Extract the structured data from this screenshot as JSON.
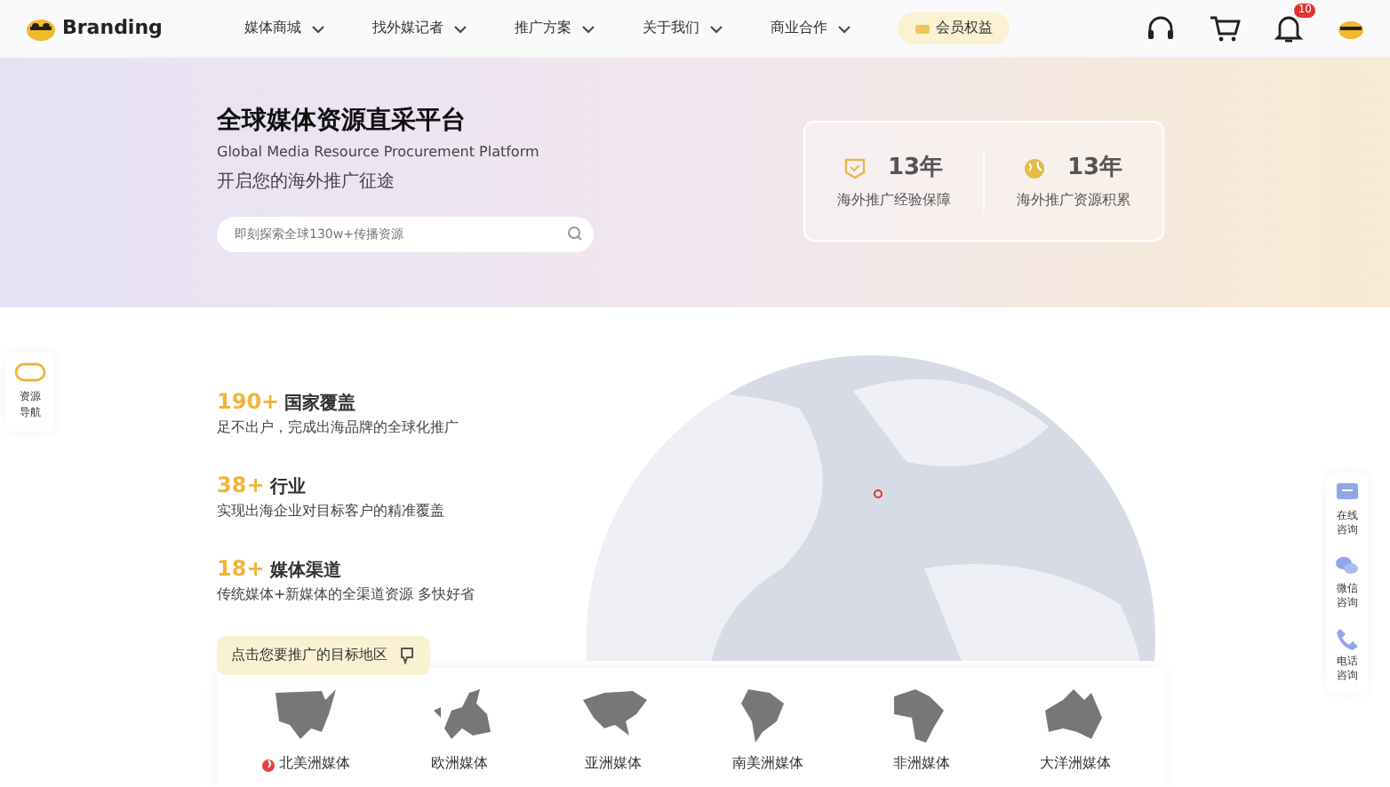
{
  "header": {
    "logo_text": "Branding",
    "nav": [
      {
        "label": "媒体商城",
        "dropdown": true
      },
      {
        "label": "找外媒记者",
        "dropdown": true
      },
      {
        "label": "推广方案",
        "dropdown": true
      },
      {
        "label": "关于我们",
        "dropdown": true
      },
      {
        "label": "商业合作",
        "dropdown": true
      }
    ],
    "member": "会员权益",
    "notifications": "10"
  },
  "hero": {
    "title": "全球媒体资源直采平台",
    "subtitle": "Global Media Resource Procurement Platform",
    "tagline": "开启您的海外推广征途",
    "search": {
      "placeholder": "即刻探索全球130w+传播资源"
    },
    "stats": [
      {
        "kind": "shield",
        "value": "13年",
        "label": "海外推广经验保障"
      },
      {
        "kind": "globe",
        "value": "13年",
        "label": "海外推广资源积累"
      }
    ]
  },
  "side_nav": {
    "label": "资源导航"
  },
  "features": [
    {
      "number": "190+",
      "title": "国家覆盖",
      "desc": "足不出户，完成出海品牌的全球化推广"
    },
    {
      "number": "38+",
      "title": "行业",
      "desc": "实现出海企业对目标客户的精准覆盖"
    },
    {
      "number": "18+",
      "title": "媒体渠道",
      "desc": "传统媒体+新媒体的全渠道资源 多快好省"
    }
  ],
  "region_prompt": "点击您要推广的目标地区",
  "regions": [
    {
      "kind": "north_america",
      "label": "北美洲媒体",
      "hot": true
    },
    {
      "kind": "europe",
      "label": "欧洲媒体",
      "hot": false
    },
    {
      "kind": "asia",
      "label": "亚洲媒体",
      "hot": false
    },
    {
      "kind": "south_america",
      "label": "南美洲媒体",
      "hot": false
    },
    {
      "kind": "africa",
      "label": "非洲媒体",
      "hot": false
    },
    {
      "kind": "oceania",
      "label": "大洋洲媒体",
      "hot": false
    }
  ],
  "contact": [
    {
      "kind": "chat",
      "label": "在线咨询"
    },
    {
      "kind": "wechat",
      "label": "微信咨询"
    },
    {
      "kind": "phone",
      "label": "电话咨询"
    }
  ]
}
